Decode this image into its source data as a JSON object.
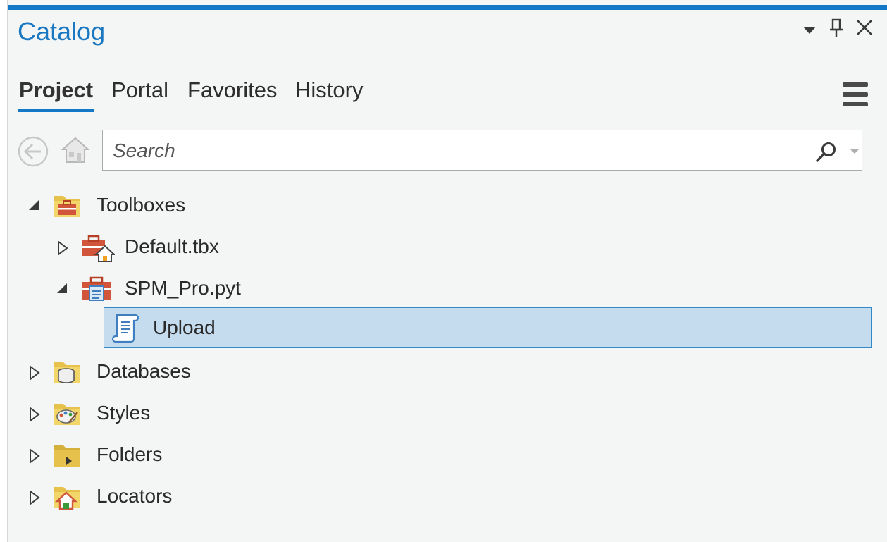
{
  "window": {
    "title": "Catalog",
    "accent_color": "#1478c8",
    "controls": [
      "dropdown",
      "pin",
      "close"
    ]
  },
  "tabs": [
    {
      "label": "Project",
      "active": true
    },
    {
      "label": "Portal",
      "active": false
    },
    {
      "label": "Favorites",
      "active": false
    },
    {
      "label": "History",
      "active": false
    }
  ],
  "search": {
    "placeholder": "Search",
    "value": ""
  },
  "tree": {
    "toolboxes": {
      "label": "Toolboxes",
      "expanded": true
    },
    "default_tbx": {
      "label": "Default.tbx",
      "expanded": false
    },
    "spm_pro": {
      "label": "SPM_Pro.pyt",
      "expanded": true
    },
    "upload": {
      "label": "Upload",
      "selected": true
    },
    "databases": {
      "label": "Databases",
      "expanded": false
    },
    "styles": {
      "label": "Styles",
      "expanded": false
    },
    "folders": {
      "label": "Folders",
      "expanded": false
    },
    "locators": {
      "label": "Locators",
      "expanded": false
    }
  }
}
